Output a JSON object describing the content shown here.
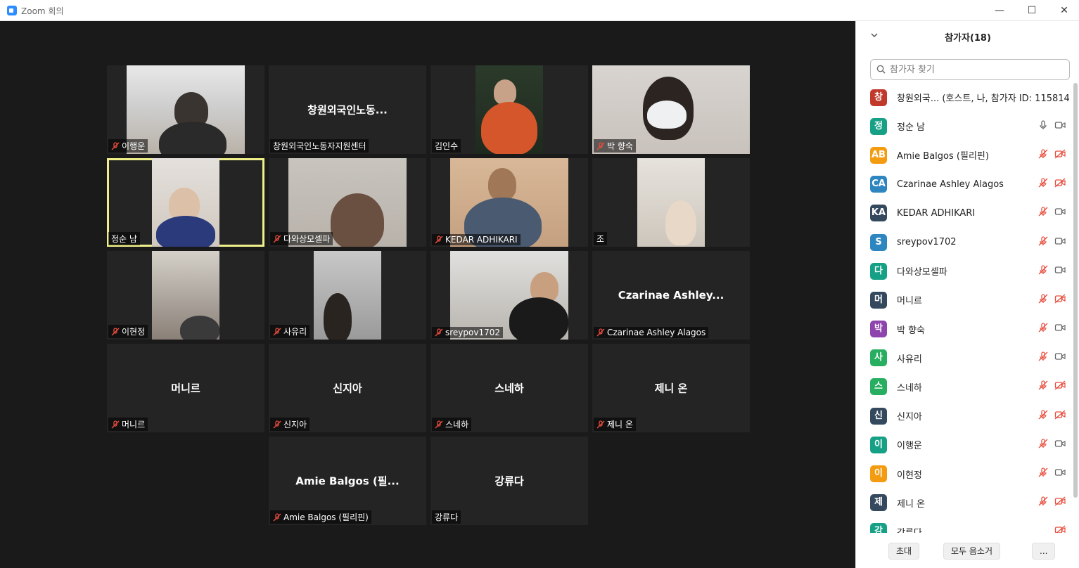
{
  "window": {
    "title": "Zoom 회의",
    "minimize": "—",
    "maximize": "☐",
    "close": "✕"
  },
  "tiles": [
    {
      "label": "이행운",
      "muted": true,
      "video": true
    },
    {
      "label": "창원외국인노동자지원센터",
      "center": "창원외국인노동...",
      "muted": false,
      "video": false
    },
    {
      "label": "김인수",
      "muted": false,
      "video": true
    },
    {
      "label": "박 향숙",
      "muted": true,
      "video": true
    },
    {
      "label": "정순 남",
      "muted": false,
      "video": true,
      "active": true
    },
    {
      "label": "다와상모셀파",
      "muted": true,
      "video": true
    },
    {
      "label": "KEDAR ADHIKARI",
      "muted": true,
      "video": true
    },
    {
      "label": "조",
      "muted": false,
      "video": true
    },
    {
      "label": "이현정",
      "muted": true,
      "video": true
    },
    {
      "label": "사유리",
      "muted": true,
      "video": true
    },
    {
      "label": "sreypov1702",
      "muted": true,
      "video": true
    },
    {
      "label": "Czarinae Ashley Alagos",
      "center": "Czarinae  Ashley...",
      "muted": true,
      "video": false
    },
    {
      "label": "머니르",
      "center": "머니르",
      "muted": true,
      "video": false
    },
    {
      "label": "신지아",
      "center": "신지아",
      "muted": true,
      "video": false
    },
    {
      "label": "스네하",
      "center": "스네하",
      "muted": true,
      "video": false
    },
    {
      "label": "제니 온",
      "center": "제니 온",
      "muted": true,
      "video": false
    },
    {
      "label": "Amie Balgos (필리핀)",
      "center": "Amie Balgos (필...",
      "muted": true,
      "video": false
    },
    {
      "label": "강류다",
      "center": "강류다",
      "muted": false,
      "video": false
    }
  ],
  "panel": {
    "title": "참가자(18)",
    "search_placeholder": "참가자 찾기",
    "participants": [
      {
        "initial": "창",
        "name": "창원외국... (호스트, 나, 참가자 ID: 115814)",
        "color": "#c0392b",
        "mic": "none",
        "cam": "none"
      },
      {
        "initial": "정",
        "name": "정순 남",
        "color": "#16a085",
        "mic": "on",
        "cam": "on"
      },
      {
        "initial": "AB",
        "name": "Amie Balgos (필리핀)",
        "color": "#f39c12",
        "mic": "off",
        "cam": "off"
      },
      {
        "initial": "CA",
        "name": "Czarinae Ashley Alagos",
        "color": "#2e86c1",
        "mic": "off",
        "cam": "off"
      },
      {
        "initial": "KA",
        "name": "KEDAR ADHIKARI",
        "color": "#34495e",
        "mic": "off",
        "cam": "on"
      },
      {
        "initial": "S",
        "name": "sreypov1702",
        "color": "#2e86c1",
        "mic": "off",
        "cam": "on"
      },
      {
        "initial": "다",
        "name": "다와상모셀파",
        "color": "#16a085",
        "mic": "off",
        "cam": "on"
      },
      {
        "initial": "머",
        "name": "머니르",
        "color": "#34495e",
        "mic": "off",
        "cam": "off"
      },
      {
        "initial": "박",
        "name": "박 향숙",
        "color": "#8e44ad",
        "mic": "off",
        "cam": "on"
      },
      {
        "initial": "사",
        "name": "사유리",
        "color": "#27ae60",
        "mic": "off",
        "cam": "on"
      },
      {
        "initial": "스",
        "name": "스네하",
        "color": "#27ae60",
        "mic": "off",
        "cam": "off"
      },
      {
        "initial": "신",
        "name": "신지아",
        "color": "#34495e",
        "mic": "off",
        "cam": "off"
      },
      {
        "initial": "이",
        "name": "이행운",
        "color": "#16a085",
        "mic": "off",
        "cam": "on"
      },
      {
        "initial": "이",
        "name": "이현정",
        "color": "#f39c12",
        "mic": "off",
        "cam": "on"
      },
      {
        "initial": "제",
        "name": "제니 온",
        "color": "#34495e",
        "mic": "off",
        "cam": "off"
      },
      {
        "initial": "강",
        "name": "강류다",
        "color": "#16a085",
        "mic": "none",
        "cam": "off"
      }
    ],
    "footer": {
      "invite": "초대",
      "mute_all": "모두 음소거",
      "more": "..."
    }
  }
}
